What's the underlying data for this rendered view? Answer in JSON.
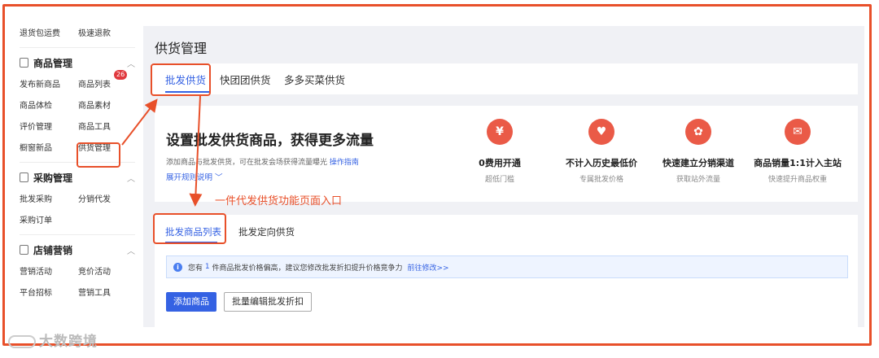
{
  "sidebar": {
    "top": [
      "退货包运费",
      "极速退款"
    ],
    "groups": [
      {
        "title": "商品管理",
        "items": [
          "发布新商品",
          "商品列表",
          "商品体检",
          "商品素材",
          "评价管理",
          "商品工具",
          "橱窗新品",
          "供货管理"
        ],
        "badge": "26"
      },
      {
        "title": "采购管理",
        "items": [
          "批发采购",
          "分销代发",
          "采购订单"
        ]
      },
      {
        "title": "店铺营销",
        "items": [
          "营销活动",
          "竞价活动",
          "平台招标",
          "营销工具"
        ]
      }
    ]
  },
  "main": {
    "title": "供货管理",
    "tabs": [
      "批发供货",
      "快团团供货",
      "多多买菜供货"
    ],
    "promo": {
      "title": "设置批发供货商品，获得更多流量",
      "desc_prefix": "添加商品",
      "desc_body": "与批发供货，可在批发会场获得流量曝光",
      "guide": "操作指南",
      "expand": "展开规则说明",
      "features": [
        {
          "icon": "¥",
          "title": "0费用开通",
          "sub": "超低门槛"
        },
        {
          "icon": "♥",
          "title": "不计入历史最低价",
          "sub": "专属批发价格"
        },
        {
          "icon": "✿",
          "title": "快速建立分销渠道",
          "sub": "获取站外流量"
        },
        {
          "icon": "✉",
          "title": "商品销量1:1计入主站",
          "sub": "快速提升商品权重"
        }
      ]
    },
    "subtabs": [
      "批发商品列表",
      "批发定向供货"
    ],
    "notice": {
      "pre": "您有",
      "count": "1",
      "post": "件商品批发价格偏高，建议您修改批发折扣提升价格竞争力",
      "link": "前往修改>>"
    },
    "buttons": {
      "add": "添加商品",
      "batch": "批量编辑批发折扣"
    }
  },
  "annotation": "一件代发供货功能页面入口",
  "watermark": "大数跨境",
  "colors": {
    "accent": "#3562e3",
    "highlight": "#e8502a",
    "icon_red": "#ea5a47"
  }
}
